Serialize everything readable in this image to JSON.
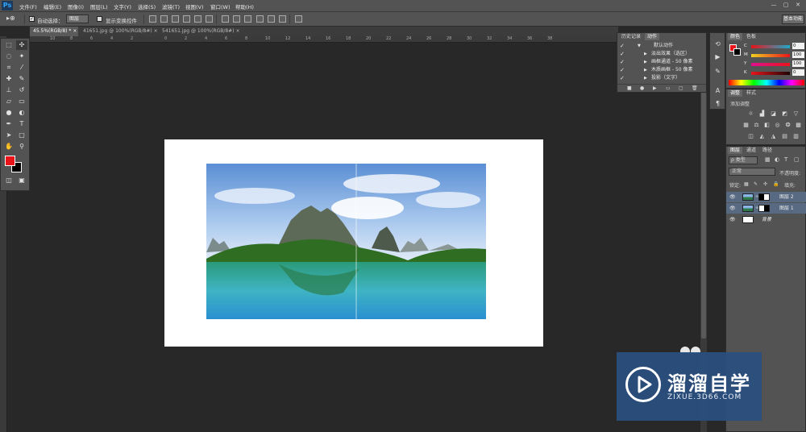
{
  "app": {
    "logo": "Ps"
  },
  "menus": [
    "文件(F)",
    "编辑(E)",
    "图像(I)",
    "图层(L)",
    "文字(Y)",
    "选择(S)",
    "滤镜(T)",
    "视图(V)",
    "窗口(W)",
    "帮助(H)"
  ],
  "window_controls": [
    "—",
    "▢",
    "✕"
  ],
  "options_bar": {
    "auto_select_label": "自动选择：",
    "auto_select_value": "图层",
    "show_transform_label": "显示变换控件",
    "workspace": "基本功能"
  },
  "tabs": [
    {
      "label": "45.5%(RGB/8) *",
      "close": "×"
    },
    {
      "label": "41651.jpg @ 100%(RGB/8#)",
      "close": "×"
    },
    {
      "label": "541651.jpg @ 100%(RGB/8#)",
      "close": "×"
    }
  ],
  "ruler_ticks": [
    "10",
    "8",
    "6",
    "4",
    "2",
    "0",
    "2",
    "4",
    "6",
    "8",
    "10",
    "12",
    "14",
    "16",
    "18",
    "20",
    "22",
    "24",
    "26",
    "28",
    "30",
    "32",
    "34",
    "36",
    "38"
  ],
  "actions_panel": {
    "tabs": [
      "历史记录",
      "动作"
    ],
    "rows": [
      {
        "check": "✓",
        "expand": "▼",
        "label": "默认动作"
      },
      {
        "check": "✓",
        "expand": "▶",
        "label": "淡出效果（选区）"
      },
      {
        "check": "✓",
        "expand": "▶",
        "label": "画框通道 - 50 像素"
      },
      {
        "check": "✓",
        "expand": "▶",
        "label": "木质画框 - 50 像素"
      },
      {
        "check": "✓",
        "expand": "▶",
        "label": "投影（文字）"
      }
    ]
  },
  "color_panel": {
    "tabs": [
      "颜色",
      "色板"
    ],
    "channels": [
      {
        "name": "C",
        "value": "0",
        "color": "#00c8d8"
      },
      {
        "name": "M",
        "value": "100",
        "color": "#e000a0"
      },
      {
        "name": "Y",
        "value": "100",
        "color": "#e8e000"
      },
      {
        "name": "K",
        "value": "0",
        "color": "#555555"
      }
    ]
  },
  "adjustments_panel": {
    "tabs": [
      "调整",
      "样式"
    ],
    "title": "添加调整"
  },
  "layers_panel": {
    "tabs": [
      "图层",
      "通道",
      "路径"
    ],
    "kind_label": "ρ 类型",
    "blend_mode": "正常",
    "opacity_label": "不透明度:",
    "lock_label": "锁定:",
    "fill_label": "填充:",
    "layers": [
      {
        "name": "图层 2",
        "selected": true
      },
      {
        "name": "图层 1",
        "selected": true
      },
      {
        "name": "背景",
        "selected": false
      }
    ]
  },
  "watermark": {
    "title": "溜溜自学",
    "url": "ZIXUE.3D66.COM"
  }
}
